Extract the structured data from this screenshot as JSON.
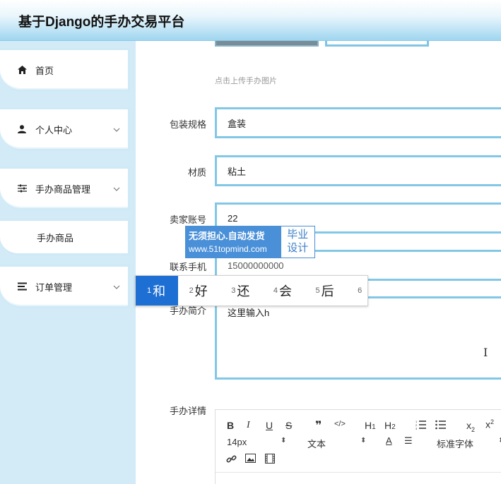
{
  "header": {
    "title": "基于Django的手办交易平台"
  },
  "sidebar": {
    "items": [
      {
        "label": "首页",
        "icon": "home-icon"
      },
      {
        "label": "个人中心",
        "icon": "user-icon"
      },
      {
        "label": "手办商品管理",
        "icon": "sliders-icon"
      },
      {
        "label": "手办商品",
        "icon": ""
      },
      {
        "label": "订单管理",
        "icon": "list-icon"
      }
    ]
  },
  "form": {
    "upload_hint": "点击上传手办图片",
    "packaging": {
      "label": "包装规格",
      "value": "盒装"
    },
    "material": {
      "label": "材质",
      "value": "粘土"
    },
    "seller": {
      "label": "卖家账号",
      "value": "22"
    },
    "phone": {
      "label": "联系手机",
      "value": "15000000000"
    },
    "intro": {
      "label": "手办简介",
      "value": "这里输入h"
    },
    "detail": {
      "label": "手办详情"
    }
  },
  "ime": {
    "candidates": [
      {
        "num": "1",
        "text": "和"
      },
      {
        "num": "2",
        "text": "好"
      },
      {
        "num": "3",
        "text": "还"
      },
      {
        "num": "4",
        "text": "会"
      },
      {
        "num": "5",
        "text": "后"
      },
      {
        "num": "6",
        "text": ""
      }
    ]
  },
  "watermark": {
    "line1": "无须担心.自动发货",
    "line2": "www.51topmind.com",
    "right1": "毕业",
    "right2": "设计"
  },
  "editor": {
    "font_size": "14px",
    "paragraph": "文本",
    "font_family": "标准字体",
    "toolbar": [
      "B",
      "I",
      "U",
      "S",
      "❞",
      "</>",
      "H1",
      "H2",
      "ordered-list",
      "unordered-list",
      "x2-sub",
      "x2-sup"
    ]
  },
  "colors": {
    "accent": "#82c7e6",
    "sidebar_bg": "#d3ebf7",
    "ime_select": "#1e6fd4"
  }
}
